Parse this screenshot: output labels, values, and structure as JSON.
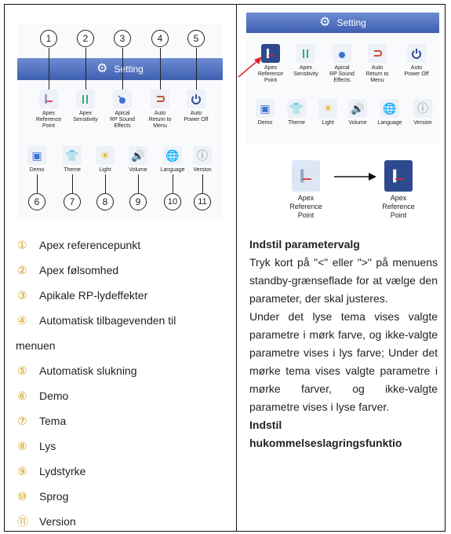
{
  "left_screen": {
    "header": "Setting",
    "row1": [
      {
        "label": "Apex\nReference\nPoint",
        "icon": "apex-reference-icon"
      },
      {
        "label": "Apex\nSensitivity",
        "icon": "sensitivity-icon"
      },
      {
        "label": "Apical\nRP Sound\nEffects",
        "icon": "sound-effects-icon"
      },
      {
        "label": "Auto\nReturn to\nMenu",
        "icon": "return-icon"
      },
      {
        "label": "Auto\nPower Off",
        "icon": "power-icon"
      }
    ],
    "row2": [
      {
        "label": "Demo",
        "icon": "demo-icon"
      },
      {
        "label": "Theme",
        "icon": "theme-icon"
      },
      {
        "label": "Light",
        "icon": "light-icon"
      },
      {
        "label": "Volume",
        "icon": "volume-icon"
      },
      {
        "label": "Language",
        "icon": "language-icon"
      },
      {
        "label": "Version",
        "icon": "version-icon"
      }
    ],
    "callouts_top": [
      "1",
      "2",
      "3",
      "4",
      "5"
    ],
    "callouts_bottom": [
      "6",
      "7",
      "8",
      "9",
      "10",
      "11"
    ]
  },
  "legend": [
    {
      "num": "①",
      "text": "Apex referencepunkt"
    },
    {
      "num": "②",
      "text": "Apex følsomhed"
    },
    {
      "num": "③",
      "text": "Apikale RP-lydeffekter"
    },
    {
      "num": "④",
      "text": "Automatisk tilbagevenden til"
    },
    {
      "num": "",
      "text": "menuen"
    },
    {
      "num": "⑤",
      "text": "Automatisk slukning"
    },
    {
      "num": "⑥",
      "text": "Demo"
    },
    {
      "num": "⑦",
      "text": "Tema"
    },
    {
      "num": "⑧",
      "text": "Lys"
    },
    {
      "num": "⑨",
      "text": "Lydstyrke"
    },
    {
      "num": "⑩",
      "text": "Sprog"
    },
    {
      "num": "⑪",
      "text": "Version"
    }
  ],
  "right_screen": {
    "header": "Setting",
    "row1": [
      "Apex\nReference\nPoint",
      "Apex\nSensitivity",
      "Apical\nRP Sound\nEffects",
      "Auto\nReturn to\nMenu",
      "Auto\nPower Off"
    ],
    "row2": [
      "Demo",
      "Theme",
      "Light",
      "Volume",
      "Language",
      "Version"
    ]
  },
  "compare": {
    "left_label": "Apex\nReference\nPoint",
    "right_label": "Apex\nReference\nPoint"
  },
  "right_text": {
    "heading1": "Indstil parametervalg",
    "para1": "Tryk kort på \"<\" eller \">\" på menuens standby-grænseflade for at vælge den parameter, der skal justeres.",
    "para2": "Under det lyse tema vises valgte parametre i mørk farve, og ikke-valgte parametre vises i lys farve; Under det mørke tema vises valgte parametre i mørke farver, og ikke-valgte parametre vises i lyse farver.",
    "heading2": "Indstil",
    "heading3": "hukommelseslagringsfunktio"
  },
  "colors": {
    "header_blue": "#4a6bbf",
    "selected_dark": "#2e4a8f",
    "accent_arrow": "#e0202a",
    "legend_num": "#d0a020"
  }
}
